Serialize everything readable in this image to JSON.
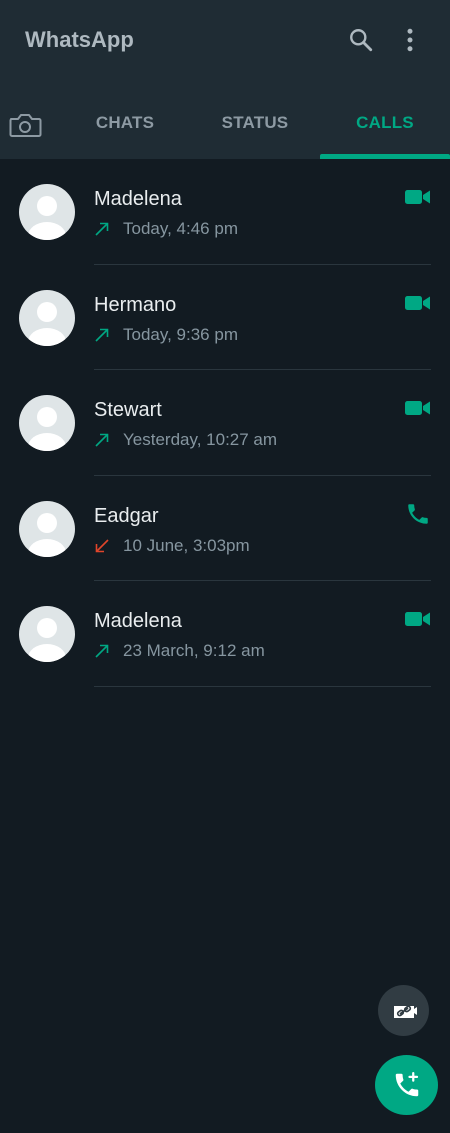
{
  "app": {
    "title": "WhatsApp"
  },
  "icons": {
    "search": "search-icon",
    "menu": "more-vert-icon",
    "camera": "camera-icon",
    "video": "videocam-icon",
    "voice": "phone-icon",
    "outgoing": "call-made-icon",
    "missed": "call-received-icon",
    "link": "link-icon",
    "new_call": "add-call-icon"
  },
  "tabs": [
    {
      "label": "CHATS"
    },
    {
      "label": "STATUS"
    },
    {
      "label": "CALLS",
      "active": true
    }
  ],
  "calls": [
    {
      "name": "Madelena",
      "time": "Today, 4:46 pm",
      "direction": "outgoing",
      "type": "video"
    },
    {
      "name": "Hermano",
      "time": "Today, 9:36 pm",
      "direction": "outgoing",
      "type": "video"
    },
    {
      "name": "Stewart",
      "time": "Yesterday, 10:27 am",
      "direction": "outgoing",
      "type": "video"
    },
    {
      "name": "Eadgar",
      "time": "10 June, 3:03pm",
      "direction": "missed",
      "type": "voice"
    },
    {
      "name": "Madelena",
      "time": "23 March, 9:12 am",
      "direction": "outgoing",
      "type": "video"
    }
  ],
  "colors": {
    "accent": "#00a884",
    "missed": "#e0452b",
    "background": "#121b22",
    "appbar": "#1f2c34"
  }
}
